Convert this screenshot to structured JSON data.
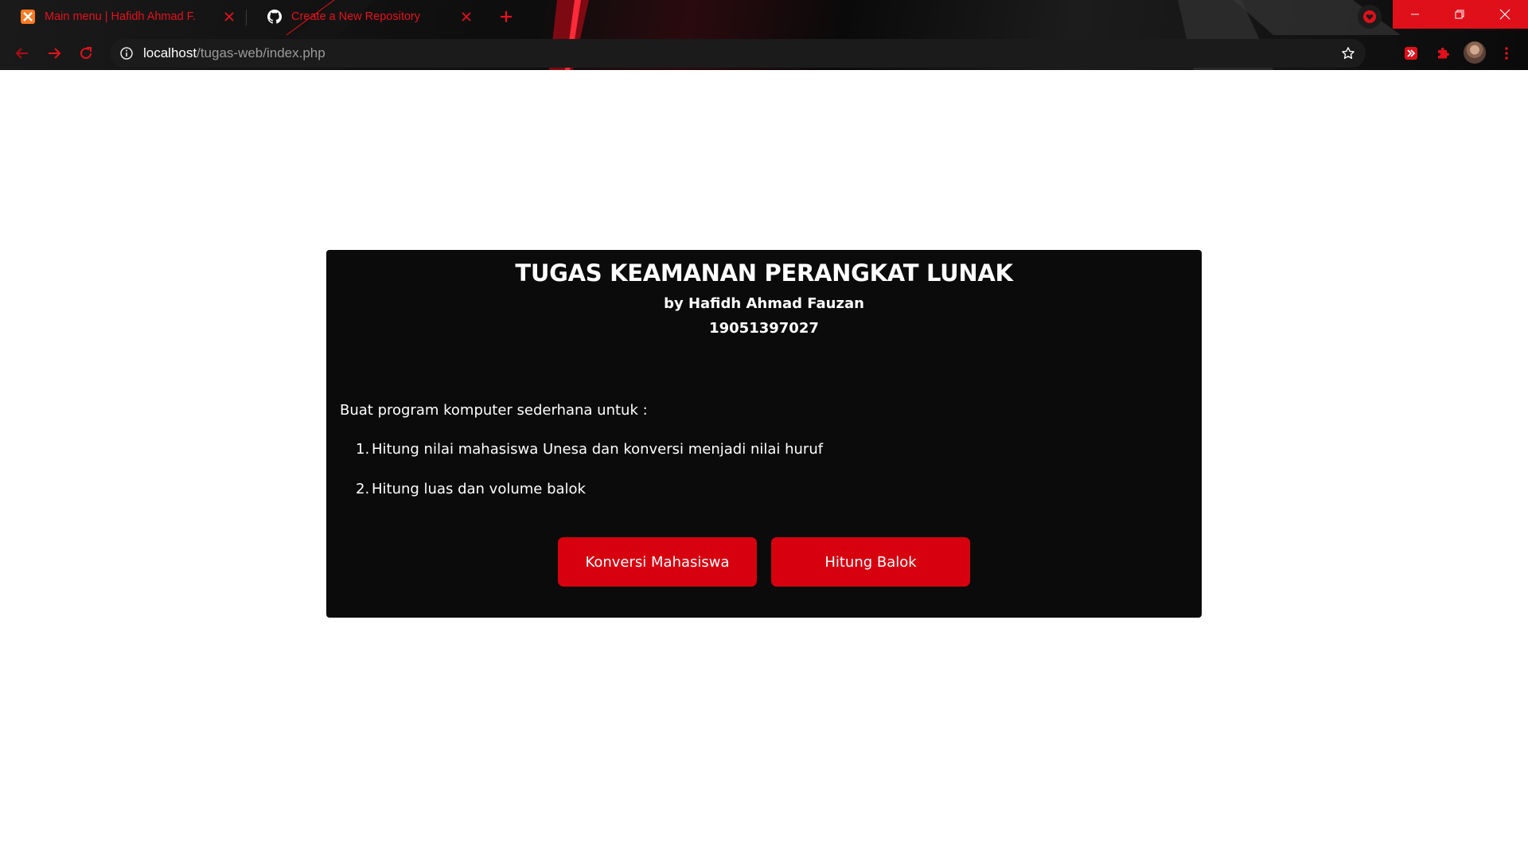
{
  "browser": {
    "tabs": [
      {
        "title": "Main menu | Hafidh Ahmad F.",
        "favicon": "xampp-icon"
      },
      {
        "title": "Create a New Repository",
        "favicon": "github-icon"
      }
    ],
    "url_host": "localhost",
    "url_path": "/tugas-web/index.php",
    "accent_color": "#e0101b"
  },
  "card": {
    "title": "TUGAS KEAMANAN PERANGKAT LUNAK",
    "author": "by Hafidh Ahmad Fauzan",
    "nim": "19051397027",
    "intro": "Buat program komputer sederhana untuk :",
    "tasks": [
      {
        "num": "1.",
        "text": "Hitung nilai mahasiswa Unesa dan konversi menjadi nilai huruf"
      },
      {
        "num": "2.",
        "text": "Hitung luas dan volume balok"
      }
    ],
    "buttons": {
      "konversi": "Konversi Mahasiswa",
      "balok": "Hitung Balok"
    },
    "button_color": "#d6000f"
  }
}
